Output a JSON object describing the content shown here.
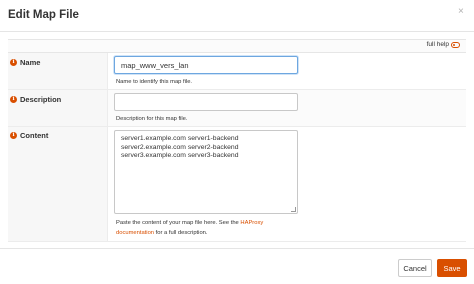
{
  "dialog": {
    "title": "Edit Map File",
    "close_glyph": "×",
    "full_help_label": "full help"
  },
  "fields": {
    "name": {
      "label": "Name",
      "value": "map_www_vers_lan",
      "hint": "Name to identify this map file."
    },
    "description": {
      "label": "Description",
      "value": "",
      "hint": "Description for this map file."
    },
    "content": {
      "label": "Content",
      "lines": [
        "server1.example.com server1-backend",
        "server2.example.com server2-backend",
        "server3.example.com server3-backend"
      ],
      "hint_pre": "Paste the content of your map file here. See the ",
      "hint_link_1": "HAProxy",
      "hint_link_2": "documentation",
      "hint_post": " for a full description."
    }
  },
  "footer": {
    "cancel_label": "Cancel",
    "save_label": "Save"
  },
  "colors": {
    "accent": "#d94f00",
    "focus_border": "#6ea7e0"
  }
}
